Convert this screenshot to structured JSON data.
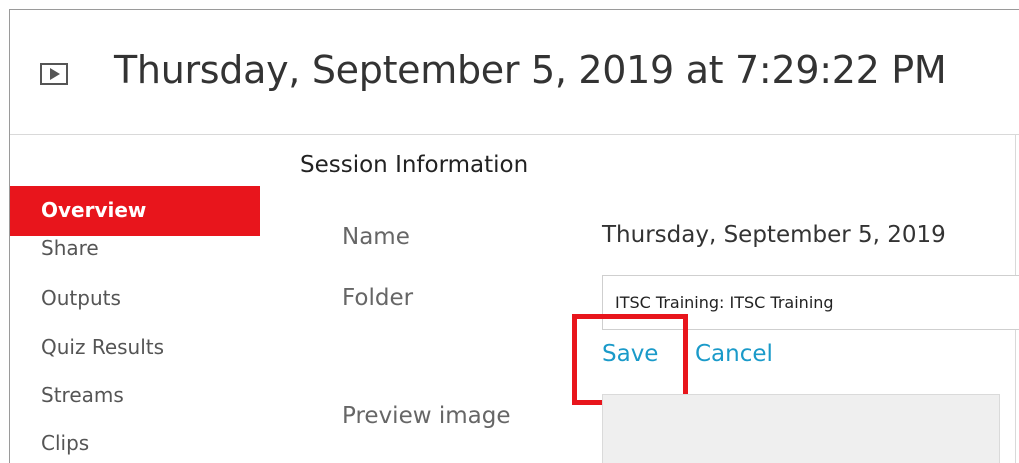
{
  "header": {
    "title": "Thursday, September 5, 2019 at 7:29:22 PM",
    "icon": "play-icon"
  },
  "section": {
    "title": "Session Information"
  },
  "sidebar": {
    "items": [
      {
        "label": "Overview",
        "active": true
      },
      {
        "label": "Share",
        "active": false
      },
      {
        "label": "Outputs",
        "active": false
      },
      {
        "label": "Quiz Results",
        "active": false
      },
      {
        "label": "Streams",
        "active": false
      },
      {
        "label": "Clips",
        "active": false
      }
    ]
  },
  "form": {
    "name_label": "Name",
    "name_value": "Thursday, September 5, 2019",
    "folder_label": "Folder",
    "folder_value": "ITSC Training: ITSC Training",
    "save_label": "Save",
    "cancel_label": "Cancel",
    "preview_label": "Preview image"
  },
  "colors": {
    "accent": "#e8151c",
    "link": "#1a9ac9"
  }
}
